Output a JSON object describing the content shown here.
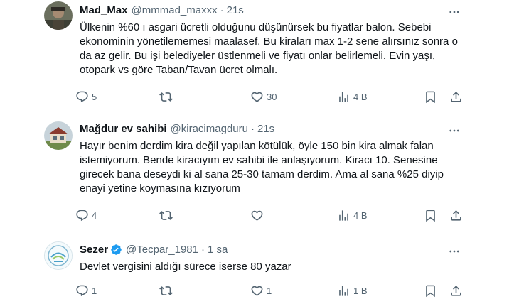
{
  "tweets": [
    {
      "name": "Mad_Max",
      "handle": "@mmmad_maxxx",
      "separator": "·",
      "time": "21s",
      "text": "Ülkenin %60 ı asgari ücretli olduğunu düşünürsek bu fiyatlar balon. Sebebi ekonominin yönetilememesi maalasef. Bu kiraları max 1-2 sene alırsınız sonra o da az gelir. Bu işi belediyeler üstlenmeli ve fiyatı onlar belirlemeli. Evin yaşı, otopark vs göre Taban/Tavan ücret olmalı.",
      "replies": "5",
      "retweets": "",
      "likes": "30",
      "views": "4 B"
    },
    {
      "name": "Mağdur ev sahibi",
      "handle": "@kiracimagduru",
      "separator": "·",
      "time": "21s",
      "text": "Hayır benim derdim kira değil yapılan kötülük, öyle 150 bin kira almak falan istemiyorum. Bende kiracıyım ev sahibi ile anlaşıyorum. Kiracı 10. Senesine girecek bana deseydi ki al sana 25-30 tamam derdim. Ama al sana %25 diyip enayi yetine koymasına kızıyorum",
      "replies": "4",
      "retweets": "",
      "likes": "",
      "views": "4 B"
    },
    {
      "name": "Sezer",
      "handle": "@Tecpar_1981",
      "separator": "·",
      "time": "1 sa",
      "text": "Devlet vergisini aldığı sürece iserse 80 yazar",
      "replies": "1",
      "retweets": "",
      "likes": "1",
      "views": "1 B"
    }
  ],
  "colors": {
    "text": "#0f1419",
    "secondary": "#536471",
    "verified": "#1d9bf0",
    "divider": "#eff3f4"
  },
  "icons": [
    "reply-icon",
    "retweet-icon",
    "like-icon",
    "views-icon",
    "bookmark-icon",
    "share-icon",
    "more-icon",
    "verified-badge-icon"
  ]
}
